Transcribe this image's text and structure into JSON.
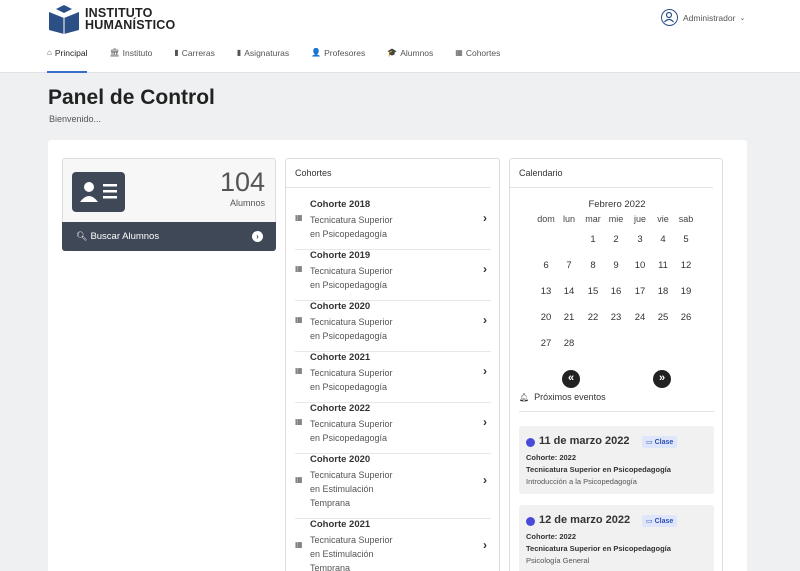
{
  "header": {
    "logo_line1": "INSTITUTO",
    "logo_line2": "HUMANÍSTICO",
    "user_name": "Administrador"
  },
  "nav": [
    {
      "label": "Principal",
      "icon": "home-icon",
      "active": true
    },
    {
      "label": "Instituto",
      "icon": "building-icon"
    },
    {
      "label": "Carreras",
      "icon": "book-icon"
    },
    {
      "label": "Asignaturas",
      "icon": "notebook-icon"
    },
    {
      "label": "Profesores",
      "icon": "user-tie-icon"
    },
    {
      "label": "Alumnos",
      "icon": "graduation-cap-icon"
    },
    {
      "label": "Cohortes",
      "icon": "table-icon"
    }
  ],
  "page": {
    "title": "Panel de Control",
    "subtitle": "Bienvenido..."
  },
  "students": {
    "count": "104",
    "label": "Alumnos",
    "search_label": "Buscar Alumnos"
  },
  "cohorts": {
    "title": "Cohortes",
    "items": [
      {
        "title": "Cohorte 2018",
        "lines": [
          "Tecnicatura Superior",
          "en Psicopedagogía"
        ]
      },
      {
        "title": "Cohorte 2019",
        "lines": [
          "Tecnicatura Superior",
          "en Psicopedagogía"
        ]
      },
      {
        "title": "Cohorte 2020",
        "lines": [
          "Tecnicatura Superior",
          "en Psicopedagogía"
        ]
      },
      {
        "title": "Cohorte 2021",
        "lines": [
          "Tecnicatura Superior",
          "en Psicopedagogía"
        ]
      },
      {
        "title": "Cohorte 2022",
        "lines": [
          "Tecnicatura Superior",
          "en Psicopedagogía"
        ]
      },
      {
        "title": "Cohorte 2020",
        "lines": [
          "Tecnicatura Superior",
          "en Estimulación",
          "Temprana"
        ]
      },
      {
        "title": "Cohorte 2021",
        "lines": [
          "Tecnicatura Superior",
          "en Estimulación",
          "Temprana"
        ]
      }
    ]
  },
  "calendar": {
    "title": "Calendario",
    "month": "Febrero 2022",
    "weekdays": [
      "dom",
      "lun",
      "mar",
      "mie",
      "jue",
      "vie",
      "sab"
    ],
    "first_weekday": 2,
    "days_in_month": 28,
    "prev_label": "«",
    "next_label": "»",
    "events_title": "Próximos eventos",
    "events": [
      {
        "date": "11 de marzo 2022",
        "badge": "Clase",
        "cohort": "Cohorte: 2022",
        "career": "Tecnicatura Superior en Psicopedagogía",
        "subject": "Introducción a la Psicopedagogía"
      },
      {
        "date": "12 de marzo 2022",
        "badge": "Clase",
        "cohort": "Cohorte: 2022",
        "career": "Tecnicatura Superior en Psicopedagogía",
        "subject": "Psicología General"
      }
    ]
  },
  "colors": {
    "accent": "#3a6cc9",
    "dark": "#3e4857",
    "event_dot": "#4a4ad9"
  }
}
